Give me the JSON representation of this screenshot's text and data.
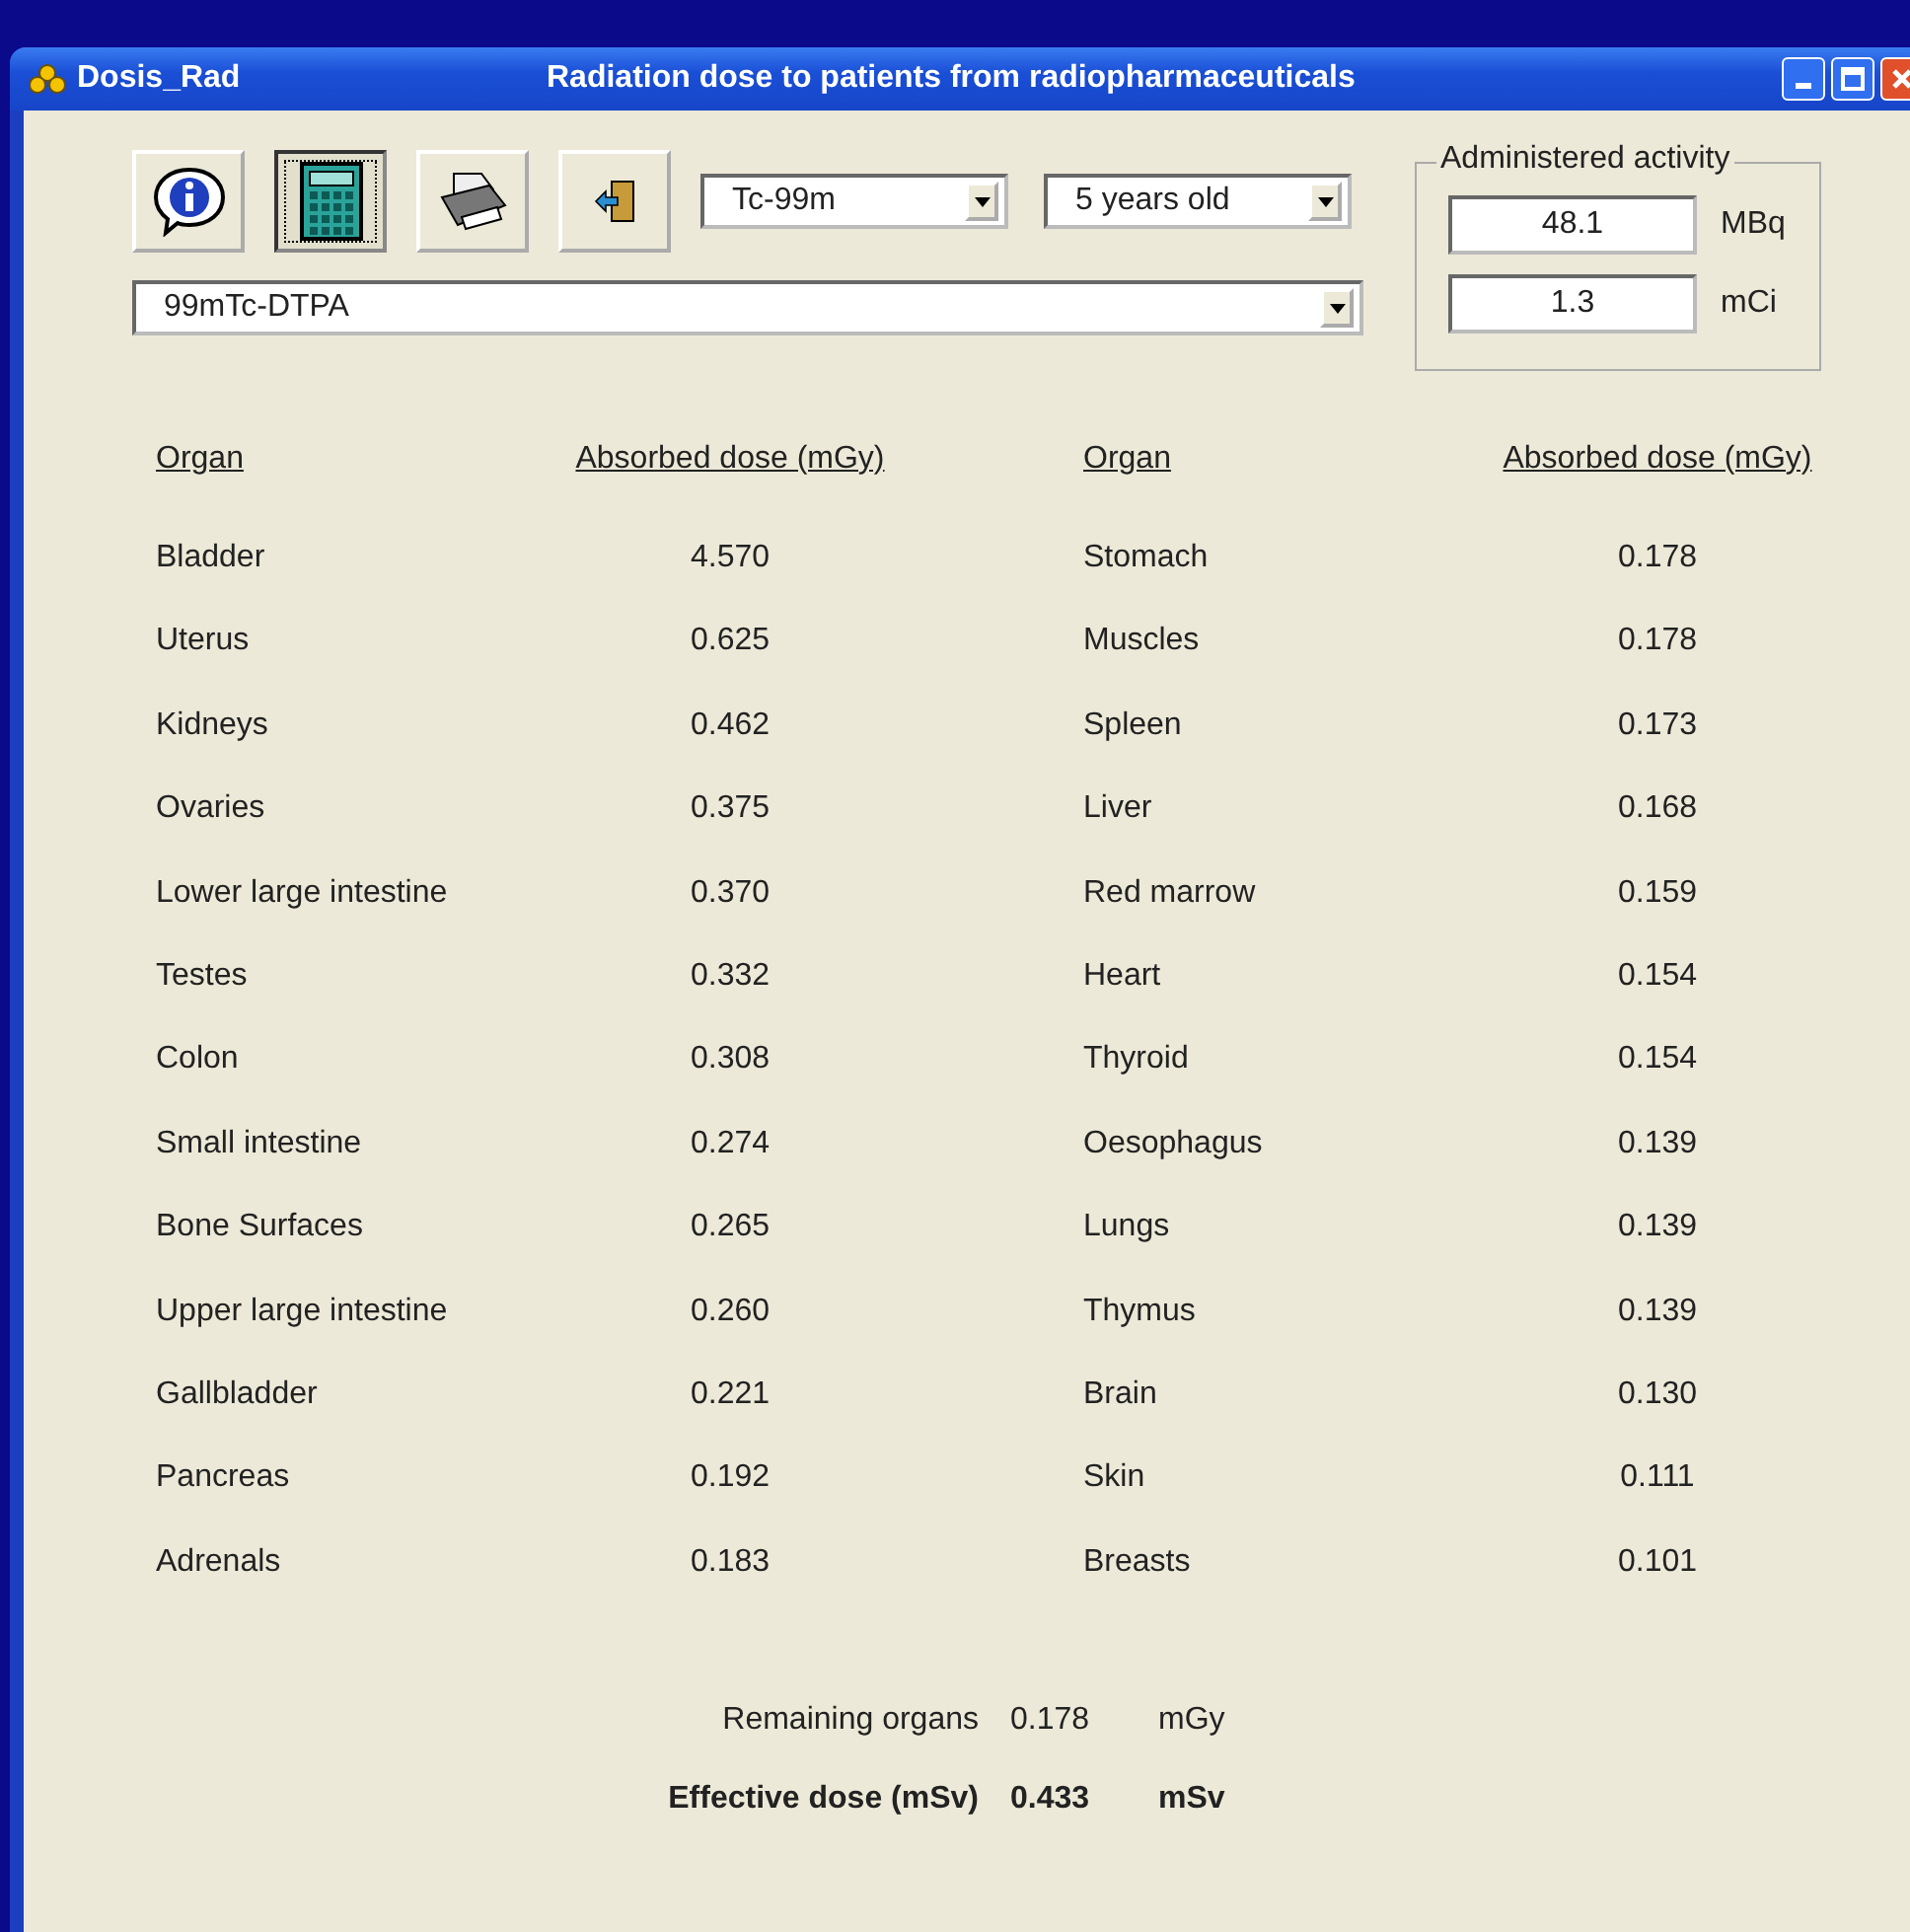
{
  "window": {
    "app_name": "Dosis_Rad",
    "title": "Radiation dose to patients from radiopharmaceuticals"
  },
  "toolbar": [
    {
      "kind": "info",
      "selected": false
    },
    {
      "kind": "calculator",
      "selected": true
    },
    {
      "kind": "printer",
      "selected": false
    },
    {
      "kind": "exit",
      "selected": false
    }
  ],
  "radionuclide": {
    "value": "Tc-99m"
  },
  "age": {
    "value": "5 years old"
  },
  "compound": {
    "value": "99mTc-DTPA"
  },
  "activity": {
    "label": "Administered activity",
    "fields": [
      {
        "value": "48.1",
        "unit": "MBq"
      },
      {
        "value": "1.3",
        "unit": "mCi"
      }
    ]
  },
  "tables": [
    {
      "columns": [
        "Organ",
        "Absorbed dose (mGy)"
      ],
      "rows": [
        {
          "organ": "Bladder",
          "dose": "4.570"
        },
        {
          "organ": "Uterus",
          "dose": "0.625"
        },
        {
          "organ": "Kidneys",
          "dose": "0.462"
        },
        {
          "organ": "Ovaries",
          "dose": "0.375"
        },
        {
          "organ": "Lower large intestine",
          "dose": "0.370"
        },
        {
          "organ": "Testes",
          "dose": "0.332"
        },
        {
          "organ": "Colon",
          "dose": "0.308"
        },
        {
          "organ": "Small intestine",
          "dose": "0.274"
        },
        {
          "organ": "Bone Surfaces",
          "dose": "0.265"
        },
        {
          "organ": "Upper large intestine",
          "dose": "0.260"
        },
        {
          "organ": "Gallbladder",
          "dose": "0.221"
        },
        {
          "organ": "Pancreas",
          "dose": "0.192"
        },
        {
          "organ": "Adrenals",
          "dose": "0.183"
        }
      ]
    },
    {
      "columns": [
        "Organ",
        "Absorbed dose (mGy)"
      ],
      "rows": [
        {
          "organ": "Stomach",
          "dose": "0.178"
        },
        {
          "organ": "Muscles",
          "dose": "0.178"
        },
        {
          "organ": "Spleen",
          "dose": "0.173"
        },
        {
          "organ": "Liver",
          "dose": "0.168"
        },
        {
          "organ": "Red marrow",
          "dose": "0.159"
        },
        {
          "organ": "Heart",
          "dose": "0.154"
        },
        {
          "organ": "Thyroid",
          "dose": "0.154"
        },
        {
          "organ": "Oesophagus",
          "dose": "0.139"
        },
        {
          "organ": "Lungs",
          "dose": "0.139"
        },
        {
          "organ": "Thymus",
          "dose": "0.139"
        },
        {
          "organ": "Brain",
          "dose": "0.130"
        },
        {
          "organ": "Skin",
          "dose": "0.111"
        },
        {
          "organ": "Breasts",
          "dose": "0.101"
        }
      ]
    }
  ],
  "summary": [
    {
      "kind": "normal",
      "label": "Remaining organs",
      "value": "0.178",
      "unit": "mGy"
    },
    {
      "kind": "bold",
      "label": "Effective dose (mSv)",
      "value": "0.433",
      "unit": "mSv"
    }
  ]
}
